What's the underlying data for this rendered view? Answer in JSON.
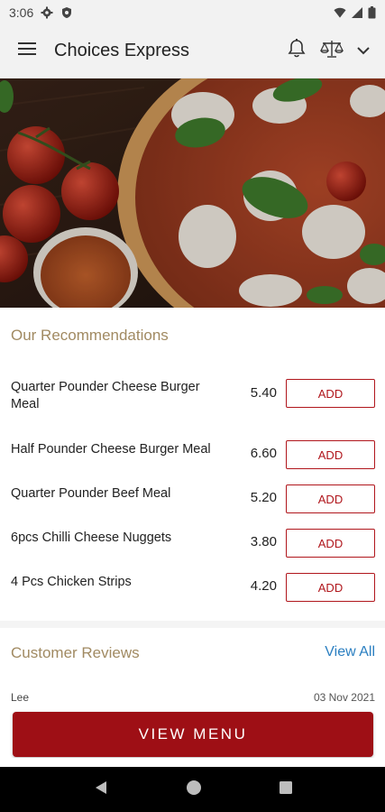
{
  "status_bar": {
    "time": "3:06"
  },
  "app_bar": {
    "title": "Choices Express"
  },
  "recommendations": {
    "title": "Our Recommendations",
    "items": [
      {
        "name": "Quarter Pounder Cheese Burger Meal",
        "price": "5.40",
        "button": "ADD"
      },
      {
        "name": "Half Pounder Cheese Burger Meal",
        "price": "6.60",
        "button": "ADD"
      },
      {
        "name": "Quarter Pounder Beef Meal",
        "price": "5.20",
        "button": "ADD"
      },
      {
        "name": "6pcs Chilli Cheese Nuggets",
        "price": "3.80",
        "button": "ADD"
      },
      {
        "name": "4 Pcs Chicken Strips",
        "price": "4.20",
        "button": "ADD"
      }
    ]
  },
  "reviews": {
    "title": "Customer Reviews",
    "view_all": "View All",
    "first": {
      "name": "Lee",
      "date": "03 Nov 2021"
    }
  },
  "cta": {
    "label": "VIEW MENU"
  },
  "colors": {
    "brand_red": "#9e0f15",
    "accent_gold": "#a18a62",
    "link_blue": "#2b7fc1"
  },
  "icons": [
    "hamburger-menu-icon",
    "bell-icon",
    "scale-icon",
    "chevron-down-icon",
    "gear-icon",
    "shield-icon",
    "wifi-icon",
    "signal-icon",
    "battery-icon",
    "back-icon",
    "home-icon",
    "recents-icon"
  ]
}
